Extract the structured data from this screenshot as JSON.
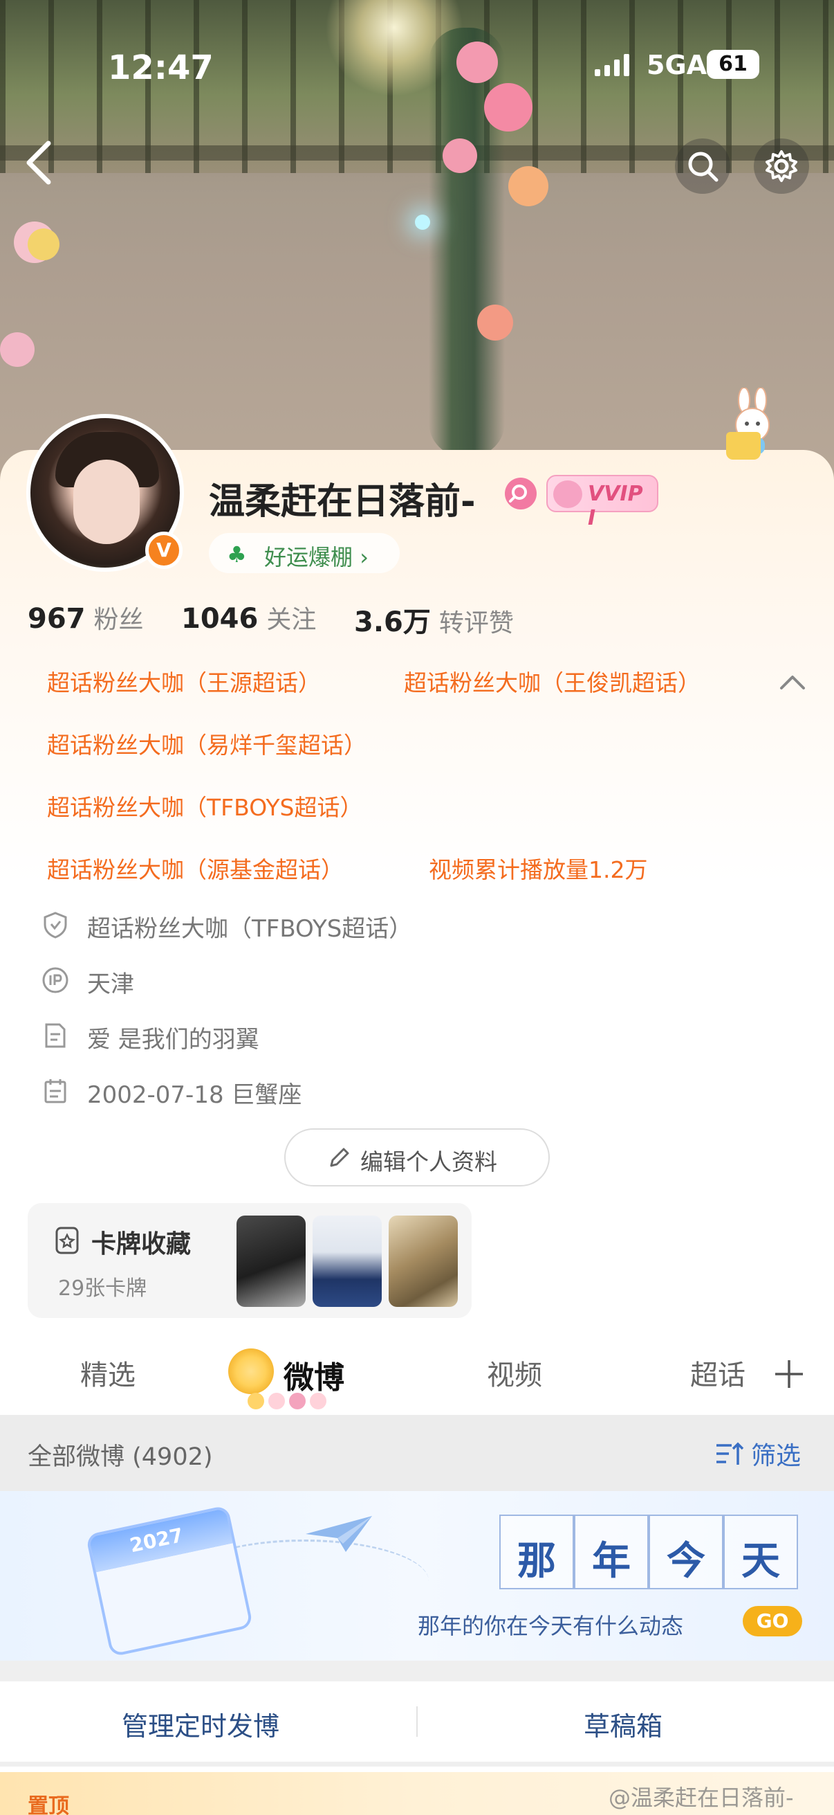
{
  "status": {
    "time": "12:47",
    "network": "5GA",
    "battery": "61"
  },
  "profile": {
    "username": "温柔赶在日落前-",
    "vip_label": "VVIP I",
    "verified_mark": "V",
    "luck_label": "好运爆棚",
    "stats": [
      {
        "value": "967",
        "label": "粉丝"
      },
      {
        "value": "1046",
        "label": "关注"
      },
      {
        "value": "3.6万",
        "label": "转评赞"
      }
    ],
    "tags": [
      "超话粉丝大咖（王源超话）",
      "超话粉丝大咖（王俊凯超话）",
      "超话粉丝大咖（易烊千玺超话）",
      "超话粉丝大咖（TFBOYS超话）",
      "超话粉丝大咖（源基金超话）",
      "视频累计播放量1.2万"
    ],
    "info": [
      {
        "icon": "shield-icon",
        "text": "超话粉丝大咖（TFBOYS超话）"
      },
      {
        "icon": "ip-icon",
        "text": "天津"
      },
      {
        "icon": "document-icon",
        "text": "爱 是我们的羽翼"
      },
      {
        "icon": "calendar-icon",
        "text": "2002-07-18 巨蟹座"
      }
    ],
    "edit_button": "编辑个人资料",
    "cards": {
      "title": "卡牌收藏",
      "count": "29张卡牌"
    }
  },
  "tabs": [
    {
      "label": "精选",
      "active": false
    },
    {
      "label": "微博",
      "active": true
    },
    {
      "label": "视频",
      "active": false
    },
    {
      "label": "超话",
      "active": false
    }
  ],
  "feed": {
    "all_label": "全部微博 (4902)",
    "filter_label": "筛选"
  },
  "banner": {
    "calendar_year": "2027",
    "title_chars": [
      "那",
      "年",
      "今",
      "天"
    ],
    "subtitle": "那年的你在今天有什么动态",
    "go": "GO"
  },
  "manage": {
    "scheduled": "管理定时发博",
    "drafts": "草稿箱"
  },
  "bottom": {
    "pinned": "置顶",
    "watermark": "@温柔赶在日落前-"
  },
  "colors": {
    "accent_orange": "#f46c1f",
    "link_blue": "#3a6fc4",
    "vip_pink": "#e2507f"
  }
}
